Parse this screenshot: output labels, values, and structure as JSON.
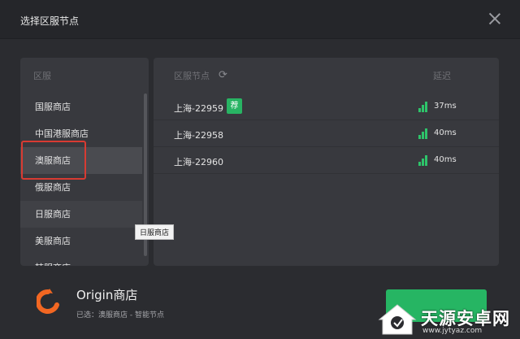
{
  "window": {
    "title": "选择区服节点"
  },
  "regions": {
    "header": "区服",
    "items": [
      {
        "label": "国服商店"
      },
      {
        "label": "中国港服商店"
      },
      {
        "label": "澳服商店"
      },
      {
        "label": "俄服商店"
      },
      {
        "label": "日服商店"
      },
      {
        "label": "美服商店"
      },
      {
        "label": "韩服商店"
      }
    ],
    "selected_index": 2,
    "hover_index": 4
  },
  "tooltip": {
    "text": "日服商店"
  },
  "nodes": {
    "header_name": "区服节点",
    "header_latency": "延迟",
    "rows": [
      {
        "name": "上海-22959",
        "badge": "荐",
        "latency": "37ms"
      },
      {
        "name": "上海-22958",
        "latency": "40ms"
      },
      {
        "name": "上海-22960",
        "latency": "40ms"
      }
    ]
  },
  "footer": {
    "store_name": "Origin商店",
    "selected_info": "已选：澳服商店 - 智能节点"
  },
  "watermark": {
    "text": "天源安卓网",
    "url": "www.jytyaz.com"
  },
  "colors": {
    "accent": "#26b563",
    "signal": "#2ec46a",
    "highlight": "#d83b32",
    "origin": "#f26722"
  }
}
